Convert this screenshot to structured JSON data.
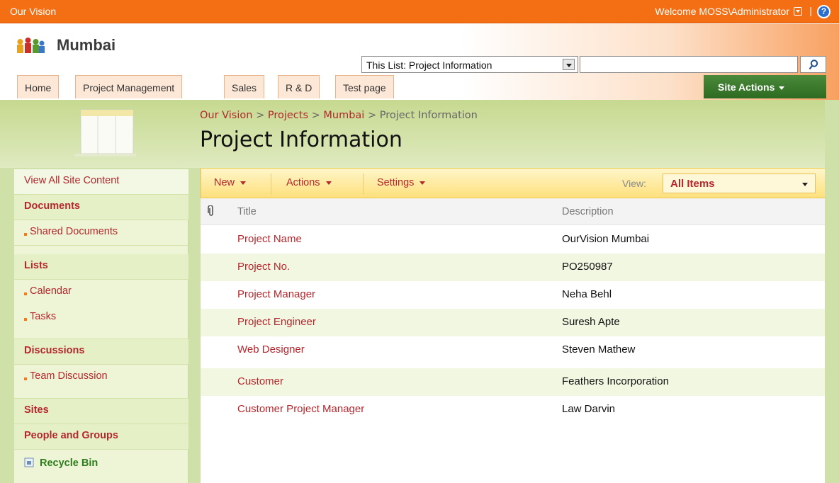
{
  "topbar": {
    "site_name": "Our Vision",
    "welcome": "Welcome MOSS\\Administrator",
    "separator": "|",
    "help": "?"
  },
  "header": {
    "site_title": "Mumbai",
    "search_scope": "This List: Project Information",
    "search_placeholder": ""
  },
  "nav": {
    "tabs": [
      "Home",
      "Project Management",
      "Sales",
      "R & D",
      "Test page"
    ],
    "site_actions": "Site Actions"
  },
  "breadcrumb": {
    "items": [
      "Our Vision",
      "Projects",
      "Mumbai",
      "Project Information"
    ],
    "separator": ">"
  },
  "page_title": "Project Information",
  "leftnav": {
    "view_all": "View All Site Content",
    "documents": "Documents",
    "shared_documents": "Shared Documents",
    "lists": "Lists",
    "calendar": "Calendar",
    "tasks": "Tasks",
    "discussions": "Discussions",
    "team_discussion": "Team Discussion",
    "sites": "Sites",
    "people_and_groups": "People and Groups",
    "recycle_bin": "Recycle Bin"
  },
  "toolbar": {
    "new": "New",
    "actions": "Actions",
    "settings": "Settings",
    "view_label": "View:",
    "view_value": "All Items"
  },
  "list": {
    "columns": [
      "Title",
      "Description"
    ],
    "rows": [
      {
        "title": "Project Name",
        "description": "OurVision Mumbai"
      },
      {
        "title": "Project No.",
        "description": "PO250987"
      },
      {
        "title": "Project Manager",
        "description": "Neha Behl"
      },
      {
        "title": "Project Engineer",
        "description": "Suresh Apte"
      },
      {
        "title": "Web Designer",
        "description": "Steven Mathew"
      },
      {
        "title": "Customer",
        "description": "Feathers Incorporation"
      },
      {
        "title": "Customer Project Manager",
        "description": "Law Darvin"
      }
    ]
  },
  "colors": {
    "topbar": "#f46f14",
    "link_red": "#b3272d",
    "site_actions_green": "#2e6b22",
    "page_bg_green": "#cfe0a8"
  }
}
